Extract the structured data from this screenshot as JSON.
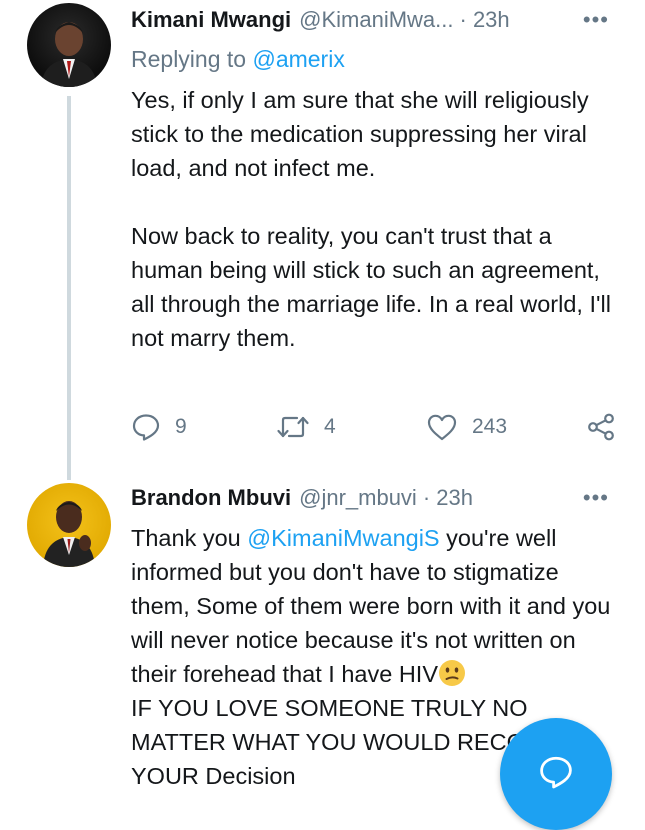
{
  "tweets": [
    {
      "display_name": "Kimani Mwangi",
      "handle": "@KimaniMwa...",
      "time": "· 23h",
      "replying_prefix": "Replying to ",
      "replying_to": "@amerix",
      "paragraph1": "Yes, if only I am sure that she will religiously stick to the medication suppressing her viral load, and not infect me.",
      "paragraph2": "Now back to reality, you can't trust that a human being will stick to such an agreement, all through the marriage life. In a real world, I'll not marry them.",
      "reply_count": "9",
      "retweet_count": "4",
      "like_count": "243"
    },
    {
      "display_name": "Brandon Mbuvi",
      "handle": "@jnr_mbuvi",
      "time": "· 23h",
      "text_before_mention": "Thank you ",
      "mention": "@KimaniMwangiS",
      "text_after_mention": " you're well informed but you don't have to  stigmatize them, Some of them were born with it and you will never notice because it's not written on their forehead that I have HIV",
      "emoji": "confused-face-emoji",
      "text_after_emoji": "IF YOU LOVE SOMEONE TRULY NO MATTER WHAT YOU WOULD RECOGNIZE YOUR Decision"
    }
  ],
  "colors": {
    "accent": "#1da1f2",
    "secondary_text": "#657786",
    "primary_text": "#14171a",
    "thread_line": "#cfd9de"
  }
}
